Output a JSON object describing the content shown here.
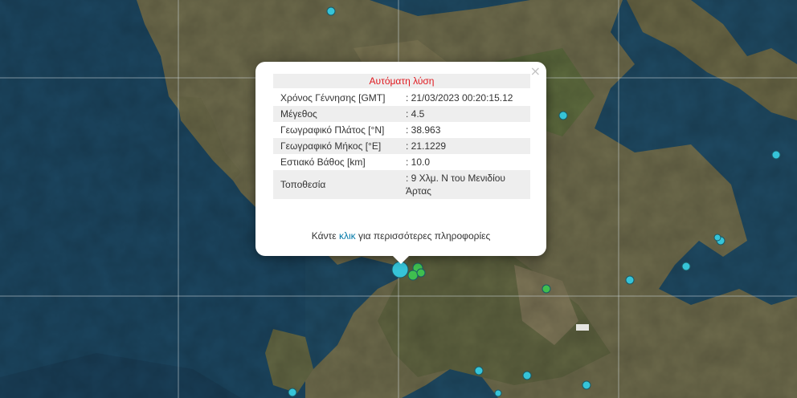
{
  "popup": {
    "title": "Αυτόματη λύση",
    "close_symbol": "×",
    "rows": [
      {
        "label": "Χρόνος Γέννησης [GMT]",
        "value": ": 21/03/2023 00:20:15.12"
      },
      {
        "label": "Μέγεθος",
        "value": ": 4.5"
      },
      {
        "label": "Γεωγραφικό Πλάτος [°N]",
        "value": ": 38.963"
      },
      {
        "label": "Γεωγραφικό Μήκος [°E]",
        "value": ": 21.1229"
      },
      {
        "label": "Εστιακό Βάθος [km]",
        "value": ": 10.0"
      },
      {
        "label": "Τοποθεσία",
        "value": ": 9 Χλμ. Ν του Μενιδίου Άρτας"
      }
    ],
    "footer_before": "Κάντε ",
    "footer_link": "κλικ",
    "footer_after": " για περισσότερες πληροφορίες"
  },
  "colors": {
    "sea": "#1f4a63",
    "land": "#6b6a4c",
    "marker_cyan": "#36c4d8",
    "marker_green": "#3fbf4f",
    "title_red": "#e0191f",
    "link_blue": "#0078a8"
  }
}
